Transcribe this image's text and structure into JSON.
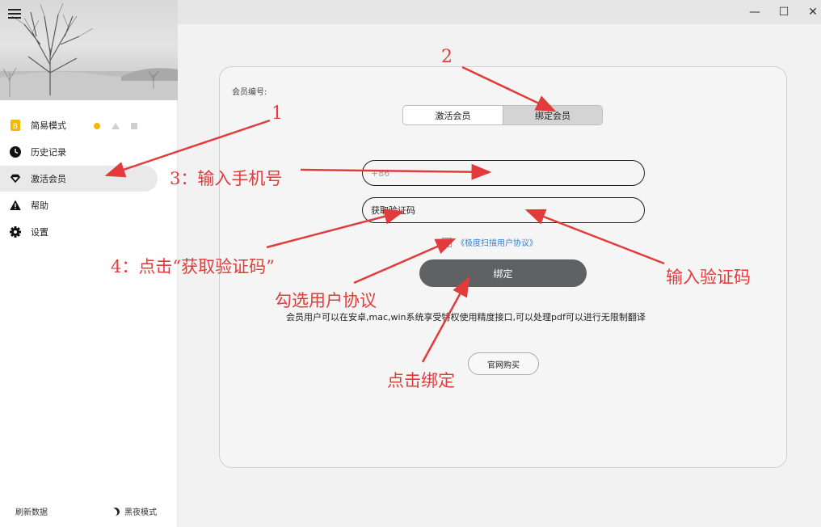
{
  "sidebar": {
    "items": [
      {
        "label": "简易模式",
        "icon": "b-badge-icon",
        "icon_color": "#f5b800"
      },
      {
        "label": "历史记录",
        "icon": "clock-icon"
      },
      {
        "label": "激活会员",
        "icon": "diamond-icon"
      },
      {
        "label": "帮助",
        "icon": "warning-icon"
      },
      {
        "label": "设置",
        "icon": "gear-icon"
      }
    ],
    "footer": {
      "refresh_label": "刷新数据",
      "dark_mode_label": "黑夜模式"
    }
  },
  "window": {
    "minimize": "—",
    "maximize": "☐",
    "close": "✕"
  },
  "main": {
    "member_no_label": "会员编号:",
    "tabs": [
      {
        "label": "激活会员"
      },
      {
        "label": "绑定会员"
      }
    ],
    "phone": {
      "placeholder": "+86"
    },
    "code": {
      "value": "获取验证码"
    },
    "agreement": {
      "text": "《极度扫描用户协议》"
    },
    "bind_label": "绑定",
    "description": "会员用户可以在安卓,mac,win系统享受特权使用精度接口,可以处理pdf可以进行无限制翻译",
    "buy_label": "官网购买"
  },
  "annotations": {
    "a1": "1",
    "a2": "2",
    "a3": "3：输入手机号",
    "a4": "4：点击“获取验证码”",
    "a_code": "输入验证码",
    "a_agree": "勾选用户协议",
    "a_bind": "点击绑定",
    "color": "#e23b3b"
  }
}
